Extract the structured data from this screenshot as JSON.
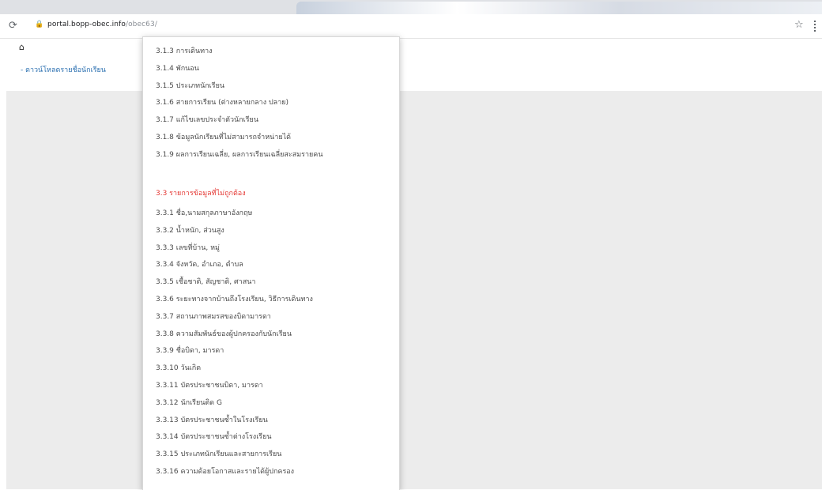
{
  "browser": {
    "reload_icon": "reload-icon",
    "lock_icon": "lock-icon",
    "url_host": "portal.bopp-obec.info",
    "url_path": "/obec63/",
    "star_icon": "star-icon"
  },
  "page": {
    "home_icon": "home-icon",
    "breadcrumb": "- ดาวน์โหลดรายชื่อนักเรียน"
  },
  "menu": {
    "group1": [
      "3.1.3 การเดินทาง",
      "3.1.4 พักนอน",
      "3.1.5 ประเภทนักเรียน",
      "3.1.6 สายการเรียน (ต่างหลายกลาง ปลาย)",
      "3.1.7 แก้ไขเลขประจำตัวนักเรียน",
      "3.1.8 ข้อมูลนักเรียนที่ไม่สามารถจำหน่ายได้",
      "3.1.9 ผลการเรียนเฉลี่ย, ผลการเรียนเฉลี่ยสะสมรายคน"
    ],
    "group2_header": "3.3 รายการข้อมูลที่ไม่ถูกต้อง",
    "group2": [
      "3.3.1 ชื่อ,นามสกุลภาษาอังกฤษ",
      "3.3.2 น้ำหนัก, ส่วนสูง",
      "3.3.3 เลขที่บ้าน, หมู่",
      "3.3.4 จังหวัด, อำเภอ, ตำบล",
      "3.3.5 เชื้อชาติ, สัญชาติ, ศาสนา",
      "3.3.6 ระยะทางจากบ้านถึงโรงเรียน, วิธีการเดินทาง",
      "3.3.7 สถานภาพสมรสของบิดามารดา",
      "3.3.8 ความสัมพันธ์ของผู้ปกครองกับนักเรียน",
      "3.3.9 ชื่อบิดา, มารดา",
      "3.3.10 วันเกิด",
      "3.3.11 บัตรประชาชนบิดา, มารดา",
      "3.3.12 นักเรียนติด G",
      "3.3.13 บัตรประชาชนซ้ำในโรงเรียน",
      "3.3.14 บัตรประชาชนซ้ำต่างโรงเรียน",
      "3.3.15 ประเภทนักเรียนและสายการเรียน",
      "3.3.16 ความด้อยโอกาสและรายได้ผู้ปกครอง"
    ]
  }
}
